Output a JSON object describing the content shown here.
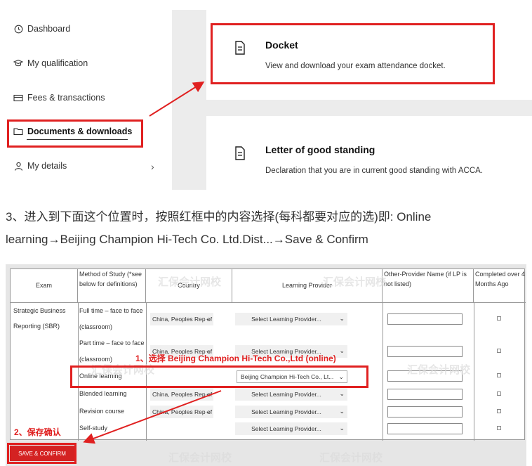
{
  "sidebar": {
    "items": [
      {
        "label": "Dashboard",
        "icon": "clock-icon"
      },
      {
        "label": "My qualification",
        "icon": "graduation-cap-icon"
      },
      {
        "label": "Fees & transactions",
        "icon": "card-icon"
      },
      {
        "label": "Documents & downloads",
        "icon": "folder-icon"
      },
      {
        "label": "My details",
        "icon": "person-icon"
      }
    ],
    "chevron": "›"
  },
  "cards": [
    {
      "title": "Docket",
      "desc": "View and download your exam attendance docket.",
      "icon": "document-icon"
    },
    {
      "title": "Letter of good standing",
      "desc": "Declaration that you are in current good standing with ACCA.",
      "icon": "document-icon"
    }
  ],
  "instruction": {
    "line1": "3、进入到下面这个位置时，按照红框中的内容选择(每科都要对应的选)即: Online",
    "line2": "learning→Beijing Champion Hi-Tech Co. Ltd.Dist...→Save & Confirm"
  },
  "table": {
    "headers": {
      "exam": "Exam",
      "method_l1": "Method of Study (*see",
      "method_l2": "below for definitions)",
      "country": "Country",
      "provider": "Learning Provider",
      "other_l1": "Other-Provider Name (if LP is",
      "other_l2": "not listed)",
      "completed_l1": "Completed over 4",
      "completed_l2": "Months Ago"
    },
    "exam_l1": "Strategic Business",
    "exam_l2": "Reporting (SBR)",
    "rows": [
      {
        "method": "Full time – face to face",
        "method2": "(classroom)",
        "country": "China, Peoples Rep of",
        "provider": "Select Learning Provider..."
      },
      {
        "method": "Part time – face to face",
        "method2": "(classroom)",
        "country": "China, Peoples Rep of",
        "provider": "Select Learning Provider..."
      },
      {
        "method": "Online learning",
        "country": "",
        "provider": "Beijing Champion Hi-Tech Co., Lt..."
      },
      {
        "method": "Blended learning",
        "country": "China, Peoples Rep of",
        "provider": "Select Learning Provider..."
      },
      {
        "method": "Revision course",
        "country": "China, Peoples Rep of",
        "provider": "Select Learning Provider..."
      },
      {
        "method": "Self-study",
        "country": "",
        "provider": "Select Learning Provider..."
      }
    ],
    "save_label": "SAVE & CONFIRM"
  },
  "annotations": {
    "step1": "1、选择 Beijing Champion Hi-Tech Co.,Ltd (online)",
    "step2": "2、保存确认"
  },
  "watermark": {
    "brand": "汇保会计网校"
  },
  "colors": {
    "highlight": "#e02020",
    "button": "#d42222"
  }
}
